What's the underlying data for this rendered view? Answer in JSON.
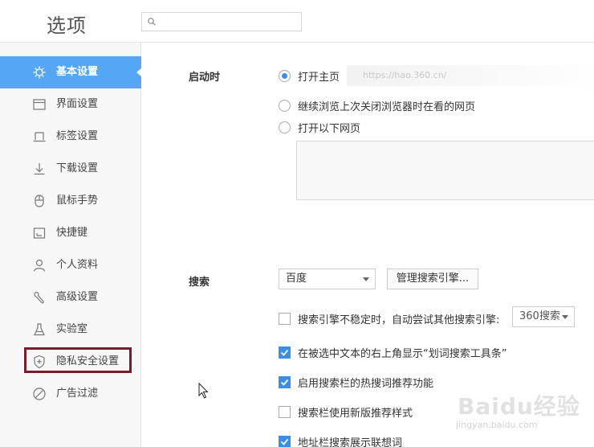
{
  "header": {
    "title": "选项",
    "search_placeholder": ""
  },
  "sidebar": {
    "items": [
      {
        "label": "基本设置",
        "icon": "gear-icon",
        "active": true
      },
      {
        "label": "界面设置",
        "icon": "window-icon"
      },
      {
        "label": "标签设置",
        "icon": "tab-icon"
      },
      {
        "label": "下载设置",
        "icon": "download-icon"
      },
      {
        "label": "鼠标手势",
        "icon": "mouse-icon"
      },
      {
        "label": "快捷键",
        "icon": "keyboard-icon"
      },
      {
        "label": "个人资料",
        "icon": "user-icon"
      },
      {
        "label": "高级设置",
        "icon": "wrench-icon"
      },
      {
        "label": "实验室",
        "icon": "flask-icon"
      },
      {
        "label": "隐私安全设置",
        "icon": "shield-icon"
      },
      {
        "label": "广告过滤",
        "icon": "block-icon"
      }
    ]
  },
  "startup": {
    "label": "启动时",
    "option_home": "打开主页",
    "home_url": "https://hao.360.cn/",
    "option_continue": "继续浏览上次关闭浏览器时在看的网页",
    "option_pages": "打开以下网页"
  },
  "search": {
    "label": "搜索",
    "engine": "百度",
    "manage_button": "管理搜索引擎...",
    "fallback_text": "搜索引擎不稳定时，自动尝试其他搜索引擎:",
    "fallback_engine": "360搜索",
    "option_word_tool": "在被选中文本的右上角显示“划词搜索工具条”",
    "option_hot_words": "启用搜索栏的热搜词推荐功能",
    "option_new_style": "搜索栏使用新版推荐样式",
    "option_address_suggest": "地址栏搜索展示联想词"
  },
  "watermark": {
    "text": "Baidu经验",
    "sub": "jingyan.baidu.com"
  },
  "colors": {
    "accent": "#55a7f5",
    "check": "#3a8ee6",
    "highlight": "#7a1a2a"
  }
}
